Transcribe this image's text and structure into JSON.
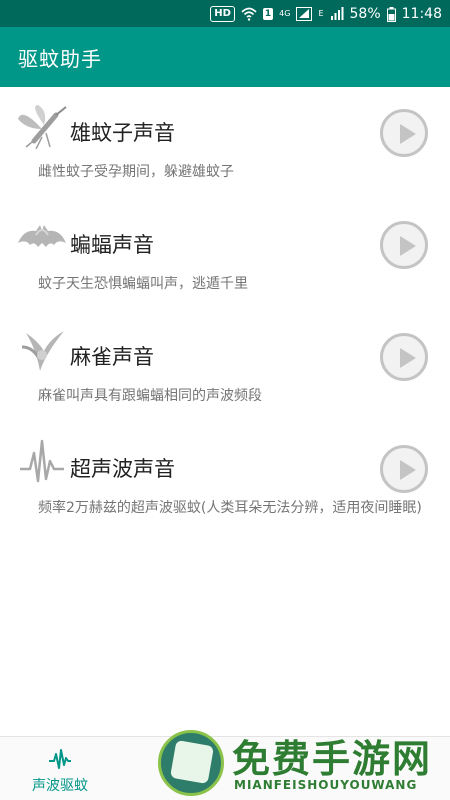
{
  "status_bar": {
    "hd": "HD",
    "sim": "1",
    "net_4g": "4G",
    "net_e": "E",
    "battery": "58%",
    "time": "11:48"
  },
  "app_bar": {
    "title": "驱蚊助手"
  },
  "items": [
    {
      "icon": "mosquito-icon",
      "title": "雄蚊子声音",
      "desc": "雌性蚊子受孕期间，躲避雄蚊子"
    },
    {
      "icon": "bat-icon",
      "title": "蝙蝠声音",
      "desc": "蚊子天生恐惧蝙蝠叫声，逃遁千里"
    },
    {
      "icon": "sparrow-icon",
      "title": "麻雀声音",
      "desc": "麻雀叫声具有跟蝙蝠相同的声波频段"
    },
    {
      "icon": "waveform-icon",
      "title": "超声波声音",
      "desc": "频率2万赫兹的超声波驱蚊(人类耳朵无法分辨，适用夜间睡眠)"
    }
  ],
  "bottom_nav": {
    "tab_label": "声波驱蚊"
  },
  "watermark": {
    "title": "免费手游网",
    "subtitle": "MIANFEISHOUYOUWANG"
  },
  "colors": {
    "primary": "#009688",
    "primary_dark": "#00695c",
    "play_button": "#c4c4c4"
  }
}
